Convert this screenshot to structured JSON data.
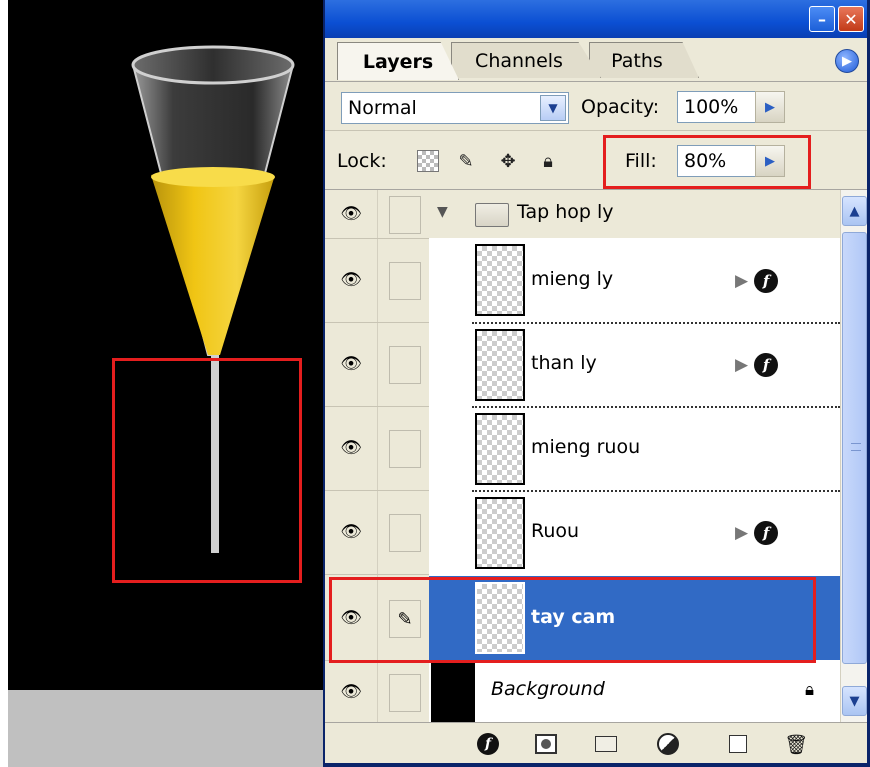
{
  "panel": {
    "tabs": [
      "Layers",
      "Channels",
      "Paths"
    ],
    "blend_mode": "Normal",
    "opacity_label": "Opacity:",
    "opacity_value": "100%",
    "lock_label": "Lock:",
    "fill_label": "Fill:",
    "fill_value": "80%",
    "window_buttons": {
      "minimize": "minimize-icon",
      "close": "close-icon"
    }
  },
  "layers": {
    "group": {
      "name": "Tap hop ly",
      "expanded": true
    },
    "items": [
      {
        "name": "mieng ly",
        "has_fx": true,
        "selected": false
      },
      {
        "name": "than ly",
        "has_fx": true,
        "selected": false
      },
      {
        "name": "mieng ruou",
        "has_fx": false,
        "selected": false
      },
      {
        "name": "Ruou",
        "has_fx": true,
        "selected": false
      },
      {
        "name": "tay cam",
        "has_fx": false,
        "selected": true
      }
    ],
    "background": {
      "name": "Background",
      "locked": true
    }
  },
  "footer_icons": [
    "link-layers-icon",
    "layer-style-icon",
    "mask-icon",
    "new-group-icon",
    "adjustment-layer-icon",
    "new-layer-icon",
    "trash-icon"
  ],
  "colors": {
    "selection": "#316ac5",
    "titlebar": "#0b4fd3",
    "highlight_box": "#e41e1e",
    "liquid": "#f2c811"
  }
}
